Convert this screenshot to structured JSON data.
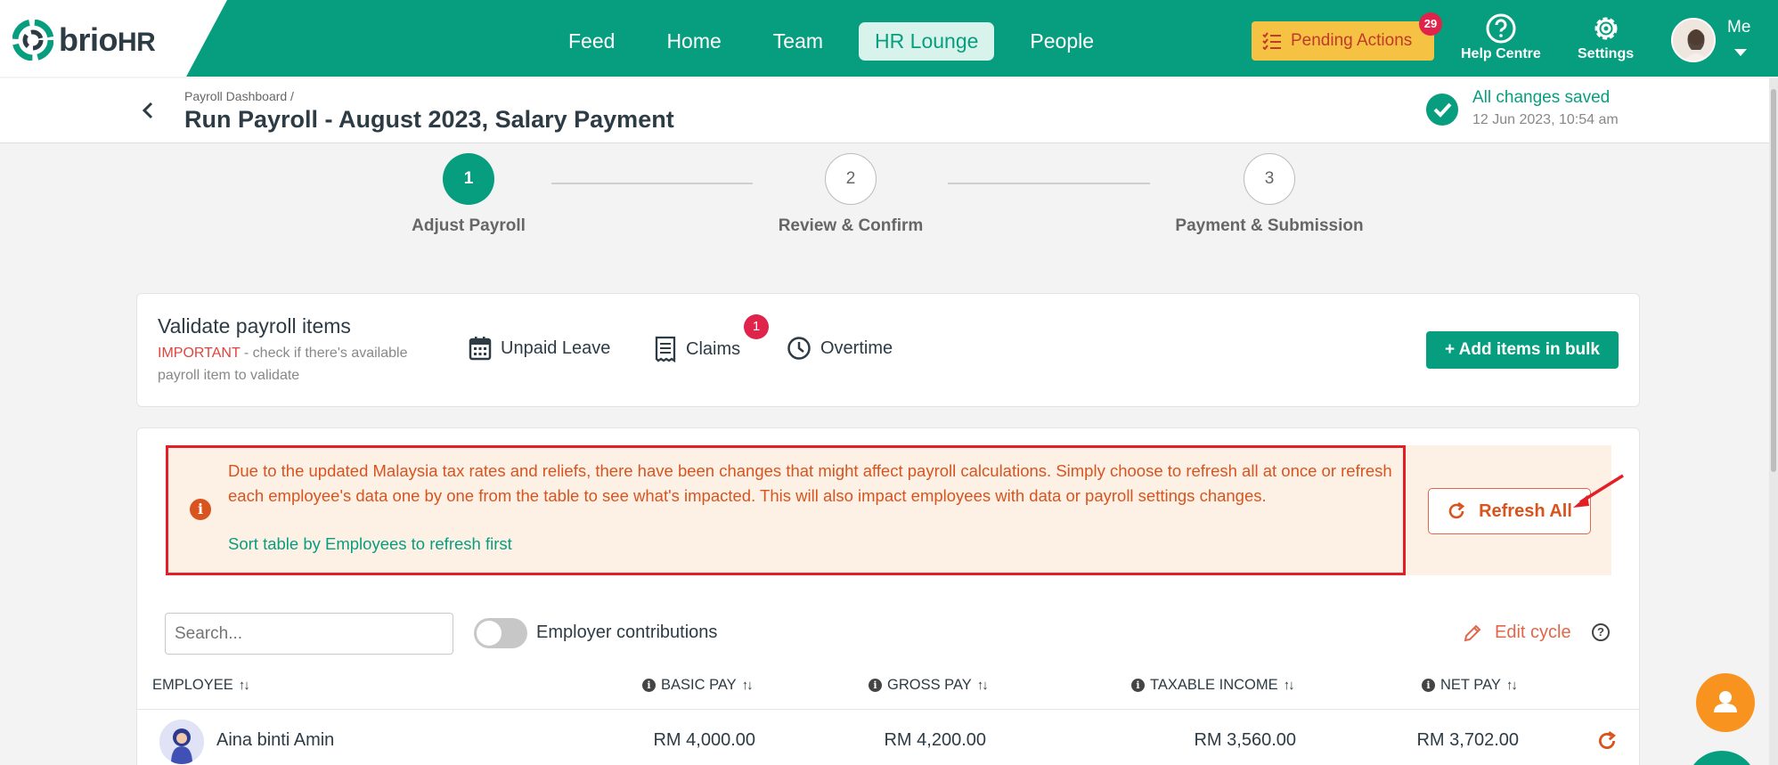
{
  "brand": {
    "logo_main": "brio",
    "logo_suffix": "HR"
  },
  "nav": {
    "items": [
      {
        "label": "Feed"
      },
      {
        "label": "Home"
      },
      {
        "label": "Team"
      },
      {
        "label": "HR Lounge",
        "active": true
      },
      {
        "label": "People"
      }
    ]
  },
  "topbar": {
    "pending_label": "Pending Actions",
    "pending_count": "29",
    "help_label": "Help Centre",
    "settings_label": "Settings",
    "user_label": "Me"
  },
  "header": {
    "breadcrumb": "Payroll Dashboard /",
    "title": "Run Payroll - August 2023, Salary Payment",
    "saved_status": "All changes saved",
    "saved_time": "12 Jun 2023, 10:54 am"
  },
  "stepper": {
    "steps": [
      {
        "number": "1",
        "label": "Adjust Payroll",
        "active": true
      },
      {
        "number": "2",
        "label": "Review & Confirm",
        "active": false
      },
      {
        "number": "3",
        "label": "Payment & Submission",
        "active": false
      }
    ]
  },
  "validate": {
    "title": "Validate payroll items",
    "important": "IMPORTANT",
    "note": " - check if there's available payroll item to validate",
    "items": [
      {
        "label": "Unpaid Leave",
        "icon": "calendar-icon"
      },
      {
        "label": "Claims",
        "icon": "receipt-icon",
        "badge": "1"
      },
      {
        "label": "Overtime",
        "icon": "clock-icon"
      }
    ],
    "bulk_button": "+ Add items in bulk"
  },
  "alert": {
    "message": "Due to the updated Malaysia tax rates and reliefs, there have been changes that might affect payroll calculations. Simply choose to refresh all at once or refresh each employee's data one by one from the table to see what's impacted. This will also impact employees with data or payroll settings changes.",
    "link": "Sort table by Employees to refresh first",
    "refresh_all": "Refresh All"
  },
  "toolbar": {
    "search_placeholder": "Search...",
    "toggle_label": "Employer contributions",
    "edit_cycle": "Edit cycle"
  },
  "table": {
    "columns": [
      "EMPLOYEE",
      "BASIC PAY",
      "GROSS PAY",
      "TAXABLE INCOME",
      "NET PAY"
    ],
    "rows": [
      {
        "employee": "Aina binti Amin",
        "basic_pay": "RM 4,000.00",
        "gross_pay": "RM 4,200.00",
        "taxable_income": "RM 3,560.00",
        "net_pay": "RM 3,702.00"
      }
    ]
  },
  "colors": {
    "brand_green": "#079e7f",
    "alert_orange": "#d9531e",
    "pending_yellow": "#f6c244",
    "badge_red": "#e0234a",
    "fab_orange": "#f7931e"
  }
}
